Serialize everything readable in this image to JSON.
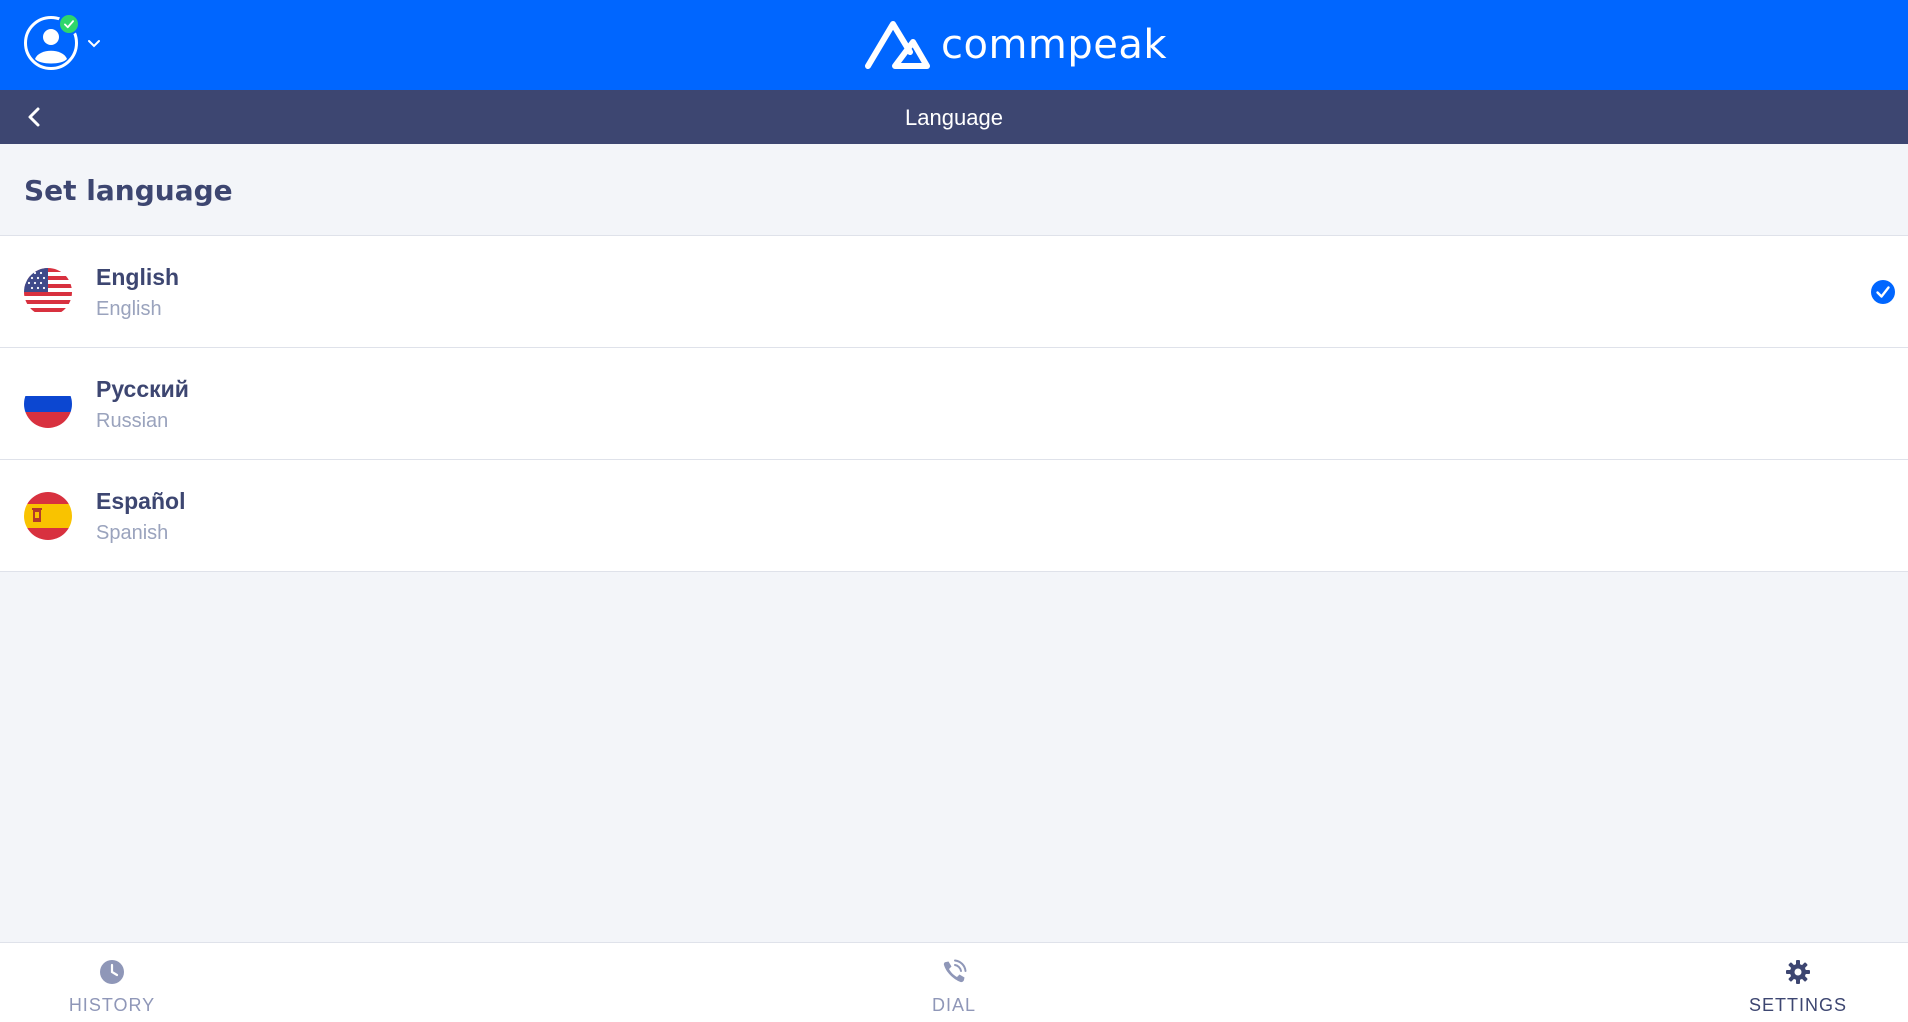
{
  "brand": {
    "name": "commpeak",
    "color": "#0066ff"
  },
  "header": {
    "title": "Language"
  },
  "section": {
    "title": "Set language"
  },
  "languages": [
    {
      "name": "English",
      "sub": "English",
      "flag": "us-flag",
      "selected": true
    },
    {
      "name": "Русский",
      "sub": "Russian",
      "flag": "ru-flag",
      "selected": false
    },
    {
      "name": "Español",
      "sub": "Spanish",
      "flag": "es-flag",
      "selected": false
    }
  ],
  "nav": [
    {
      "label": "HISTORY",
      "icon": "clock-icon",
      "active": false
    },
    {
      "label": "DIAL",
      "icon": "phone-icon",
      "active": false
    },
    {
      "label": "SETTINGS",
      "icon": "gear-icon",
      "active": true
    }
  ],
  "colors": {
    "subbar": "#3d4671",
    "accent": "#0066ff",
    "online": "#2fd66b"
  }
}
